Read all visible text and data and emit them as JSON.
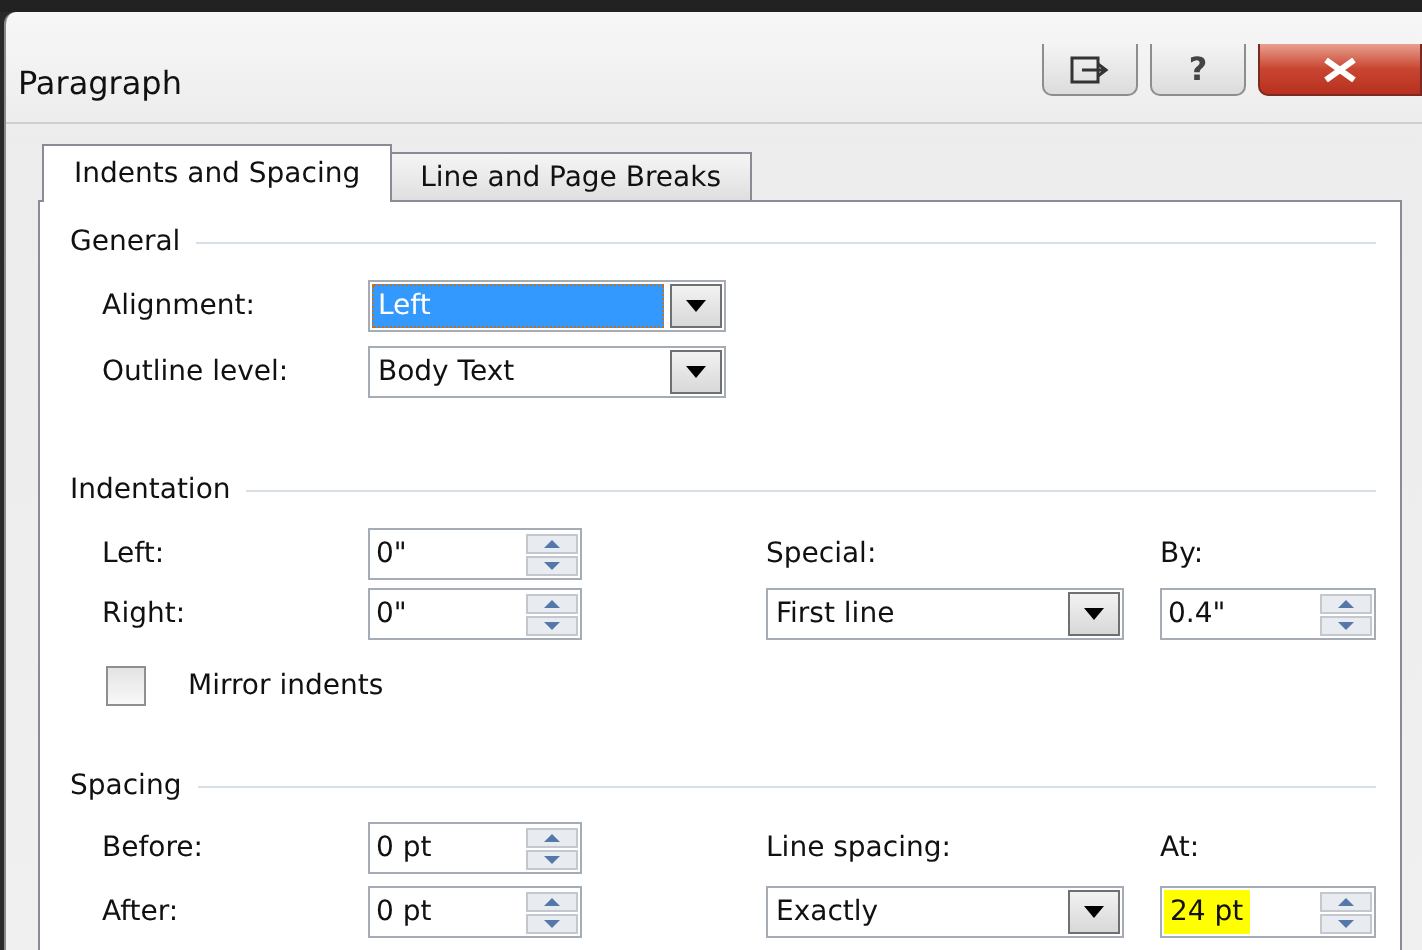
{
  "window": {
    "title": "Paragraph",
    "help_button": "?"
  },
  "tabs": [
    {
      "label": "Indents and Spacing",
      "selected": true
    },
    {
      "label": "Line and Page Breaks",
      "selected": false
    }
  ],
  "general": {
    "title": "General",
    "alignment": {
      "label": "Alignment:",
      "value": "Left",
      "focused": true
    },
    "outline_level": {
      "label": "Outline level:",
      "value": "Body Text",
      "focused": false
    }
  },
  "indentation": {
    "title": "Indentation",
    "left": {
      "label": "Left:",
      "value": "0\"",
      "highlighted": false
    },
    "right": {
      "label": "Right:",
      "value": "0\"",
      "highlighted": false
    },
    "special": {
      "label": "Special:",
      "value": "First line",
      "focused": false
    },
    "by": {
      "label": "By:",
      "value": "0.4\"",
      "highlighted": false
    },
    "mirror_indents": {
      "label": "Mirror indents",
      "checked": false
    }
  },
  "spacing": {
    "title": "Spacing",
    "before": {
      "label": "Before:",
      "value": "0 pt",
      "highlighted": false
    },
    "after": {
      "label": "After:",
      "value": "0 pt",
      "highlighted": false
    },
    "line_spacing": {
      "label": "Line spacing:",
      "value": "Exactly",
      "focused": false
    },
    "at": {
      "label": "At:",
      "value": "24 pt",
      "highlighted": true
    }
  }
}
